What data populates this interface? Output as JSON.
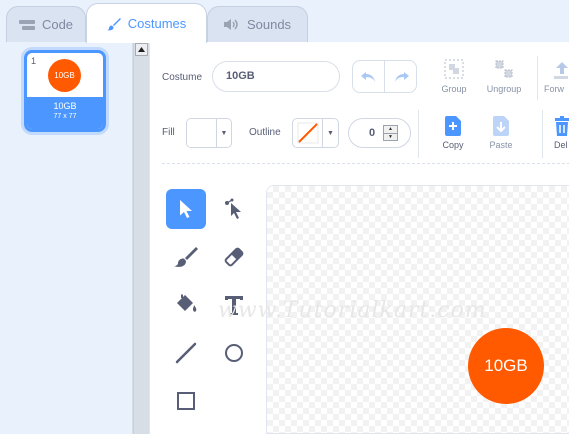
{
  "tabs": {
    "code": "Code",
    "costumes": "Costumes",
    "sounds": "Sounds"
  },
  "costume_list": {
    "number": "1",
    "thumb_text": "10GB",
    "name": "10GB",
    "size": "77 x 77"
  },
  "toolbar": {
    "costume_label": "Costume",
    "costume_name": "10GB",
    "group": "Group",
    "ungroup": "Ungroup",
    "forward": "Forw",
    "fill_label": "Fill",
    "outline_label": "Outline",
    "outline_width": "0",
    "copy": "Copy",
    "paste": "Paste",
    "delete": "Del"
  },
  "canvas": {
    "sprite_text": "10GB",
    "watermark": "www.Tutorialkart.com"
  },
  "colors": {
    "accent": "#4c97ff",
    "sprite": "#ff5a00",
    "text": "#575e75"
  }
}
